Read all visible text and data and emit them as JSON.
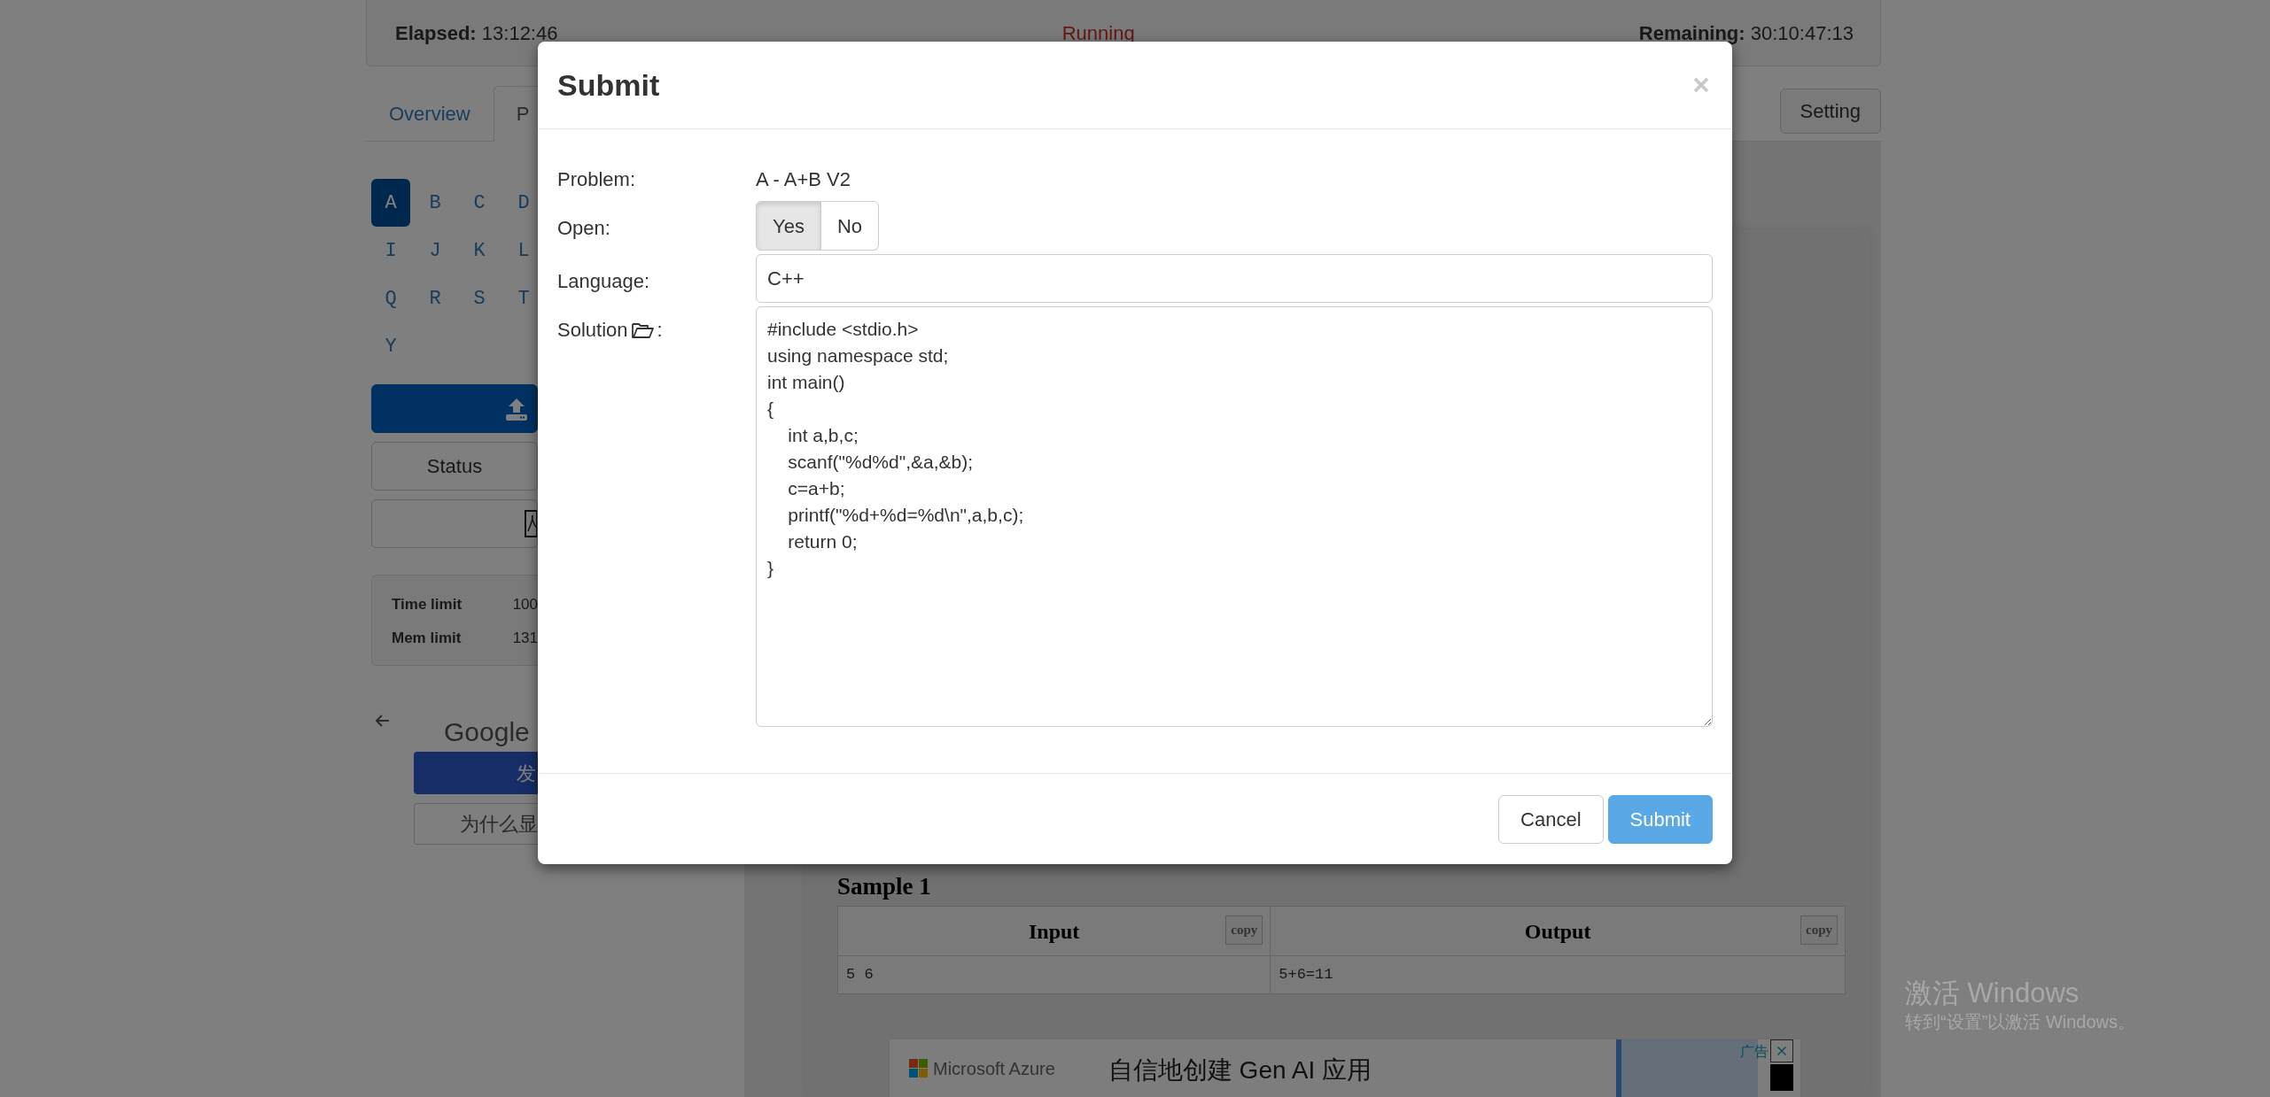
{
  "timer_bar": {
    "elapsed_label": "Elapsed:",
    "elapsed": "13:12:46",
    "status": "Running",
    "remaining_label": "Remaining:",
    "remaining": "30:10:47:13"
  },
  "tabs": [
    {
      "label": "Overview",
      "selected": false
    },
    {
      "label": "P",
      "selected": true
    }
  ],
  "setting_button": "Setting",
  "problem_letters": [
    {
      "label": "A",
      "selected": true
    },
    {
      "label": "B",
      "selected": false
    },
    {
      "label": "C",
      "selected": false
    },
    {
      "label": "D",
      "selected": false
    },
    {
      "label": "I",
      "selected": false
    },
    {
      "label": "J",
      "selected": false
    },
    {
      "label": "K",
      "selected": false
    },
    {
      "label": "L",
      "selected": false
    },
    {
      "label": "Q",
      "selected": false
    },
    {
      "label": "R",
      "selected": false
    },
    {
      "label": "S",
      "selected": false
    },
    {
      "label": "T",
      "selected": false
    },
    {
      "label": "Y",
      "selected": false
    }
  ],
  "sidebar_buttons": [
    {
      "kind": "upload"
    },
    {
      "kind": "text",
      "label": "Status"
    },
    {
      "kind": "pdf"
    }
  ],
  "limits": [
    {
      "label": "Time limit",
      "value": "100"
    },
    {
      "label": "Mem limit",
      "value": "131"
    }
  ],
  "side_ad": {
    "brand": "Google",
    "primary_button": "发",
    "secondary_button": "为什么显"
  },
  "sample": {
    "title": "Sample 1",
    "columns": [
      {
        "label": "Input",
        "copy": "copy"
      },
      {
        "label": "Output",
        "copy": "copy"
      }
    ],
    "rows": [
      [
        "5 6",
        "5+6=11"
      ]
    ]
  },
  "banner_ad": {
    "brand": "Microsoft Azure",
    "headline": "自信地创建 Gen AI 应用",
    "ad_label": "广告"
  },
  "modal": {
    "title": "Submit",
    "fields": [
      {
        "kind": "text",
        "label": "Problem:",
        "value": "A - A+B V2"
      },
      {
        "kind": "toggle",
        "label": "Open:",
        "options": [
          {
            "label": "Yes",
            "selected": true
          },
          {
            "label": "No",
            "selected": false
          }
        ]
      },
      {
        "kind": "select",
        "label": "Language:",
        "value": "C++"
      },
      {
        "kind": "code",
        "label": "Solution",
        "label_after": ":",
        "value": "#include <stdio.h>\nusing namespace std;\nint main()\n{\n    int a,b,c;\n    scanf(\"%d%d\",&a,&b);\n    c=a+b;\n    printf(\"%d+%d=%d\\n\",a,b,c);\n    return 0;\n}"
      }
    ],
    "buttons": [
      {
        "label": "Cancel",
        "kind": "default"
      },
      {
        "label": "Submit",
        "kind": "primary"
      }
    ]
  },
  "os_notice": {
    "title": "激活 Windows",
    "subtitle": "转到“设置”以激活 Windows。"
  }
}
